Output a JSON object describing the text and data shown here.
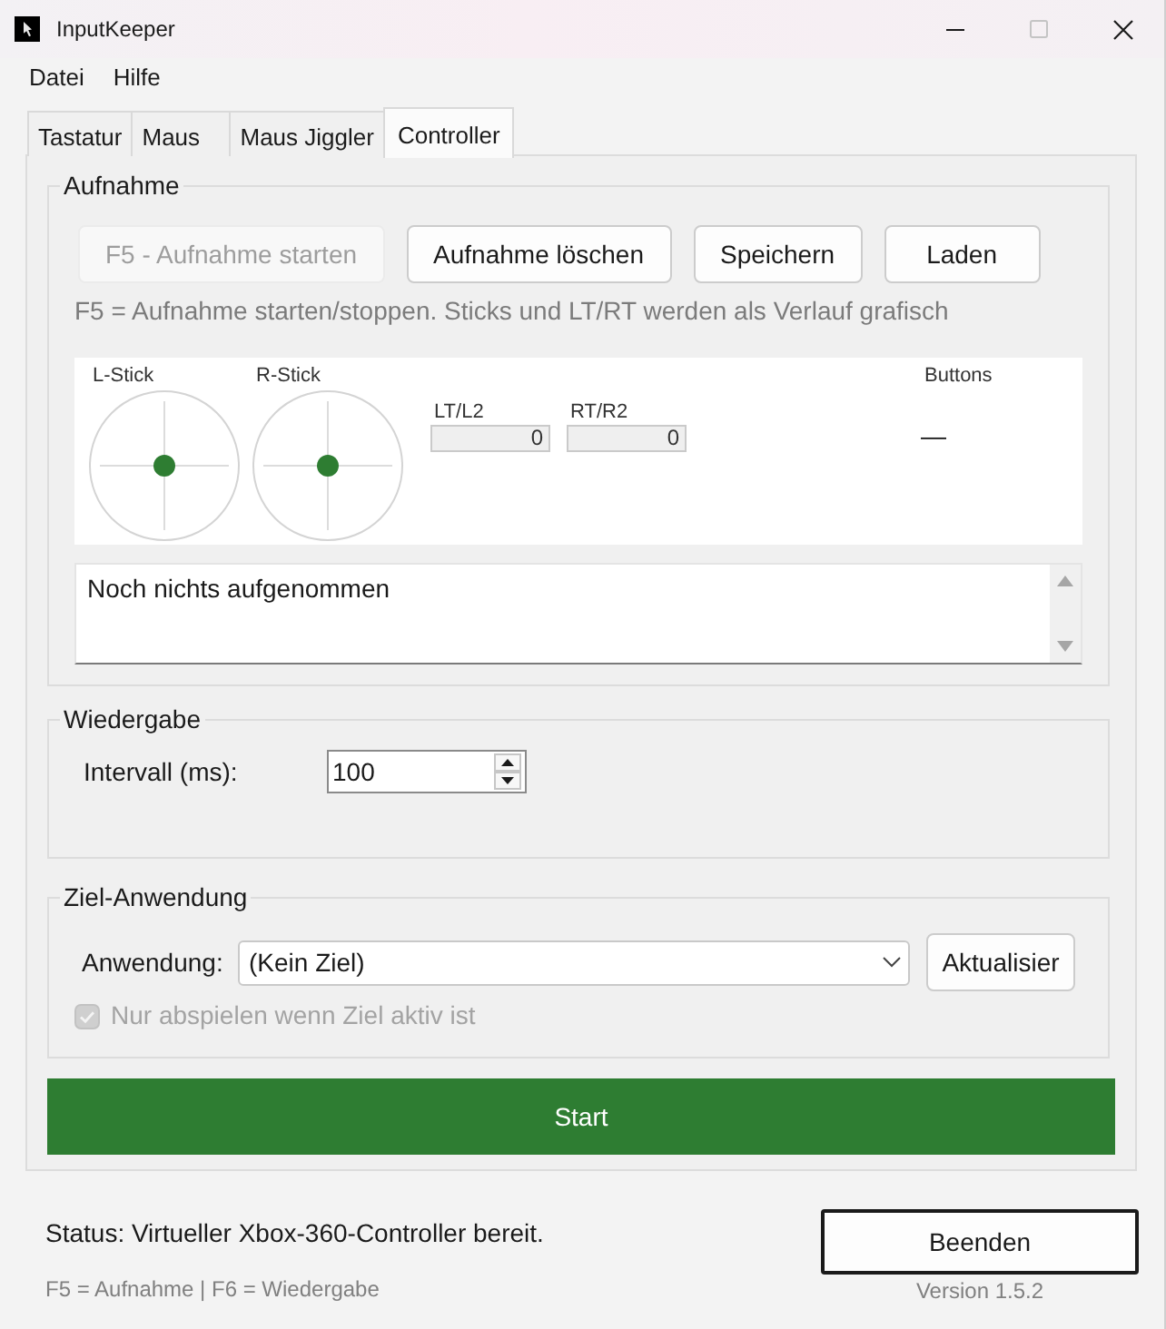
{
  "window": {
    "title": "InputKeeper",
    "controls": [
      {
        "kind": "minimize",
        "disabled": false
      },
      {
        "kind": "maximize",
        "disabled": true
      },
      {
        "kind": "close",
        "disabled": false
      }
    ]
  },
  "menu": [
    "Datei",
    "Hilfe"
  ],
  "tabs": [
    {
      "label": "Tastatur",
      "selected": false
    },
    {
      "label": "Maus",
      "selected": false
    },
    {
      "label": "Maus Jiggler",
      "selected": false
    },
    {
      "label": "Controller",
      "selected": true
    }
  ],
  "recording": {
    "title": "Aufnahme",
    "buttons": [
      {
        "label": "F5 - Aufnahme starten",
        "disabled": true
      },
      {
        "label": "Aufnahme löschen",
        "disabled": false
      },
      {
        "label": "Speichern",
        "disabled": false
      },
      {
        "label": "Laden",
        "disabled": false
      }
    ],
    "hint": "F5 = Aufnahme starten/stoppen. Sticks und LT/RT werden als Verlauf grafisch",
    "sticks": [
      {
        "label": "L-Stick"
      },
      {
        "label": "R-Stick"
      }
    ],
    "triggers": [
      {
        "label": "LT/L2",
        "value": "0"
      },
      {
        "label": "RT/R2",
        "value": "0"
      }
    ],
    "pressed_buttons": {
      "label": "Buttons",
      "value": "—"
    },
    "log": {
      "value": "Noch nichts aufgenommen"
    }
  },
  "playback": {
    "title": "Wiedergabe",
    "interval": {
      "label": "Intervall (ms):",
      "value": "100"
    }
  },
  "target": {
    "title": "Ziel-Anwendung",
    "application": {
      "label": "Anwendung:",
      "value": "(Kein Ziel)"
    },
    "refresh_button": "Aktualisier",
    "only_when_active": {
      "label": "Nur abspielen wenn Ziel aktiv ist",
      "checked": true,
      "disabled": true
    }
  },
  "start_button": "Start",
  "status": "Status: Virtueller Xbox-360-Controller bereit.",
  "hotkeys": "F5 = Aufnahme | F6 = Wiedergabe",
  "quit_button": "Beenden",
  "version": "Version 1.5.2"
}
